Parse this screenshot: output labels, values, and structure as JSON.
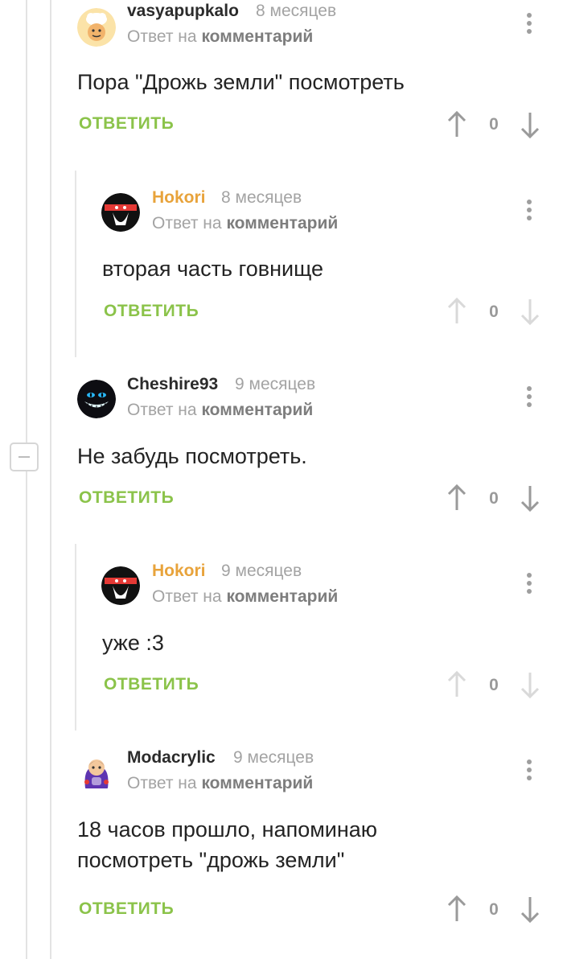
{
  "labels": {
    "reply_to_prefix": "Ответ на",
    "reply_to_target": "комментарий",
    "reply_button": "ОТВЕТИТЬ"
  },
  "comments": [
    {
      "username": "vasyapupkalo",
      "time": "8 месяцев",
      "text": "Пора \"Дрожь земли\" посмотреть",
      "votes": "0",
      "avatar_icon": "chef-icon"
    },
    {
      "username": "Hokori",
      "time": "8 месяцев",
      "text": "вторая часть говнище",
      "votes": "0",
      "avatar_icon": "masked-face-icon"
    },
    {
      "username": "Cheshire93",
      "time": "9 месяцев",
      "text": "Не забудь посмотреть.",
      "votes": "0",
      "avatar_icon": "cheshire-cat-icon"
    },
    {
      "username": "Hokori",
      "time": "9 месяцев",
      "text": "уже :3",
      "votes": "0",
      "avatar_icon": "masked-face-icon"
    },
    {
      "username": "Modacrylic",
      "time": "9 месяцев",
      "text": "18 часов прошло, напоминаю посмотреть \"дрожь земли\"",
      "votes": "0",
      "avatar_icon": "anime-figure-icon"
    }
  ],
  "colors": {
    "accent_username": "#e8a33b",
    "reply_button": "#8bc34a",
    "muted_text": "#a3a3a3",
    "thread_line": "#e3e3e3"
  }
}
